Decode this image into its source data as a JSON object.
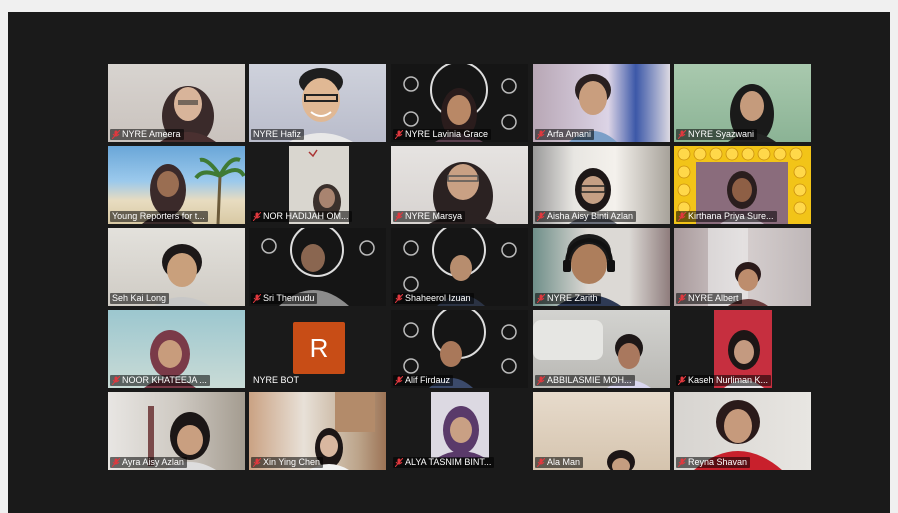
{
  "meeting": {
    "participants": [
      {
        "name": "NYRE Ameera",
        "muted": true
      },
      {
        "name": "NYRE Hafiz",
        "muted": false,
        "active_speaker": true
      },
      {
        "name": "NYRE Lavinia Grace",
        "muted": true
      },
      {
        "name": "Arfa Amani",
        "muted": true
      },
      {
        "name": "NYRE Syazwani",
        "muted": true
      },
      {
        "name": "Young Reporters for t...",
        "muted": false
      },
      {
        "name": "NOR HADIJAH OM...",
        "muted": true
      },
      {
        "name": "NYRE Marsya",
        "muted": true
      },
      {
        "name": "Aisha Aisy Binti Azlan",
        "muted": true
      },
      {
        "name": "Kirthana Priya Sure...",
        "muted": true
      },
      {
        "name": "Seh Kai Long",
        "muted": false
      },
      {
        "name": "Sri Themudu",
        "muted": true
      },
      {
        "name": "Shaheerol Izuan",
        "muted": true
      },
      {
        "name": "NYRE Zarith",
        "muted": true
      },
      {
        "name": "NYRE Albert",
        "muted": true
      },
      {
        "name": "NOOR KHATEEJA ...",
        "muted": true
      },
      {
        "name": "NYRE BOT",
        "muted": false,
        "avatar_letter": "R"
      },
      {
        "name": "Alif Firdauz",
        "muted": true
      },
      {
        "name": "ABBILASMIE MOH...",
        "muted": true
      },
      {
        "name": "Kaseh Nurliman K...",
        "muted": true
      },
      {
        "name": "Ayra Aisy Azlan",
        "muted": true
      },
      {
        "name": "Xin Ying Chen",
        "muted": true
      },
      {
        "name": "ALYA TASNIM BINT...",
        "muted": true
      },
      {
        "name": "Ala Man",
        "muted": true
      },
      {
        "name": "Reyna Shavan",
        "muted": true
      }
    ]
  },
  "colors": {
    "active_speaker_border": "#a6d86a",
    "muted_icon": "#e0383e",
    "avatar_bg": "#c84d16",
    "stage_bg": "#1a1a1a"
  }
}
